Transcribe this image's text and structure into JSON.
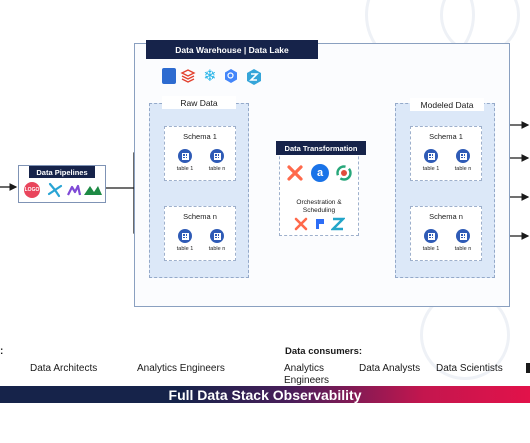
{
  "warehouse": {
    "title": "Data Warehouse | Data Lake"
  },
  "raw": {
    "title": "Raw Data",
    "schemas": [
      {
        "name": "Schema 1",
        "tables": [
          "table 1",
          "table n"
        ]
      },
      {
        "name": "Schema n",
        "tables": [
          "table 1",
          "table n"
        ]
      }
    ]
  },
  "modeled": {
    "title": "Modeled Data",
    "schemas": [
      {
        "name": "Schema 1",
        "tables": [
          "table 1",
          "table n"
        ]
      },
      {
        "name": "Schema n",
        "tables": [
          "table 1",
          "table n"
        ]
      }
    ]
  },
  "transformation": {
    "title": "Data Transformation",
    "orchestration": "Orchestration & Scheduling"
  },
  "pipelines": {
    "title": "Data Pipelines"
  },
  "roles": {
    "left_partial": ":",
    "architects": "Data Architects",
    "engineers": "Analytics Engineers"
  },
  "consumers": {
    "title": "Data consumers:",
    "items": [
      "Analytics Engineers",
      "Data Analysts",
      "Data Scientists"
    ]
  },
  "observability": "Full Data Stack Observability",
  "colors": {
    "navy": "#16234a",
    "zone": "#dce8f8",
    "accent_pink": "#e2124a",
    "table_icon": "#2f5bb6"
  }
}
